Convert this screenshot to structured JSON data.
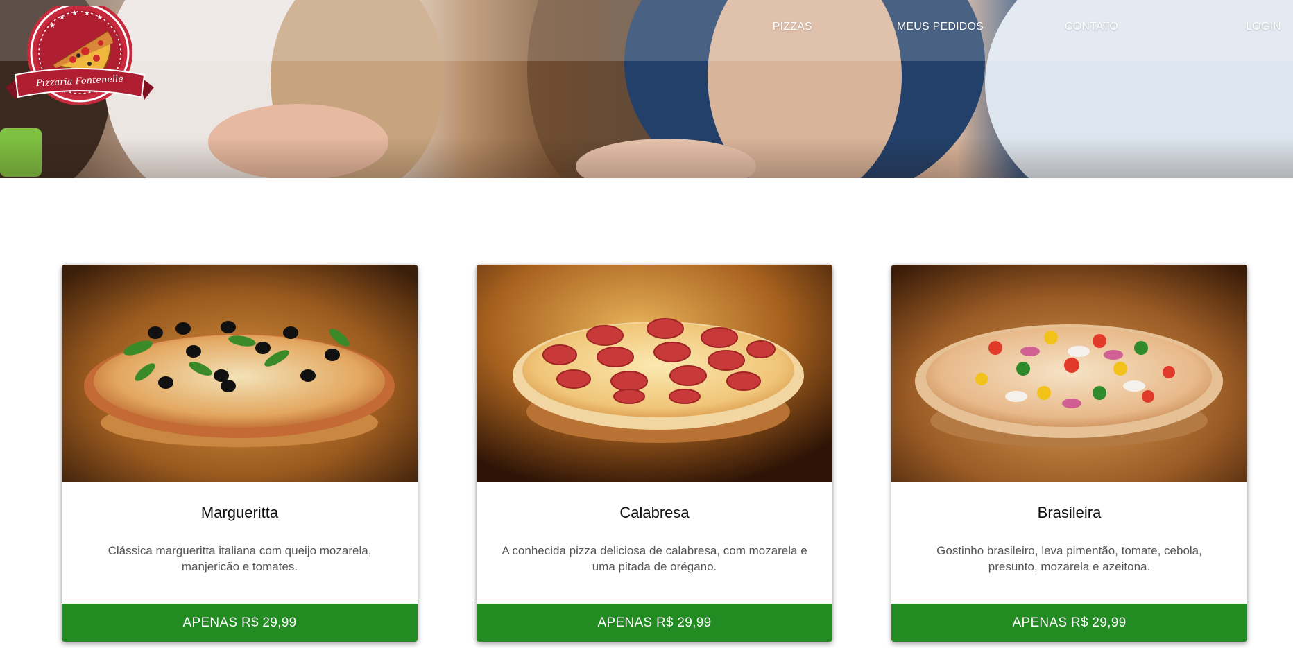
{
  "brand": {
    "name": "Pizzaria Fontenelle",
    "colors": {
      "ribbon": "#b01e32",
      "badge": "#c62a3c",
      "accent": "#228b22"
    }
  },
  "nav": {
    "items": [
      {
        "label": "PIZZAS"
      },
      {
        "label": "MEUS PEDIDOS"
      },
      {
        "label": "CONTATO"
      },
      {
        "label": "LOGIN"
      }
    ]
  },
  "hero": {
    "image": "people-sharing-pizza-photo"
  },
  "pizzas": [
    {
      "name": "Margueritta",
      "description": "Clássica margueritta italiana com queijo mozarela, manjericão e tomates.",
      "price_label": "APENAS R$ 29,99",
      "image": "margherita-pizza-photo"
    },
    {
      "name": "Calabresa",
      "description": "A conhecida pizza deliciosa de calabresa, com mozarela e uma pitada de orégano.",
      "price_label": "APENAS R$ 29,99",
      "image": "calabresa-pizza-photo"
    },
    {
      "name": "Brasileira",
      "description": "Gostinho brasileiro, leva pimentão, tomate, cebola, presunto, mozarela e azeitona.",
      "price_label": "APENAS R$ 29,99",
      "image": "brasileira-pizza-photo"
    }
  ]
}
